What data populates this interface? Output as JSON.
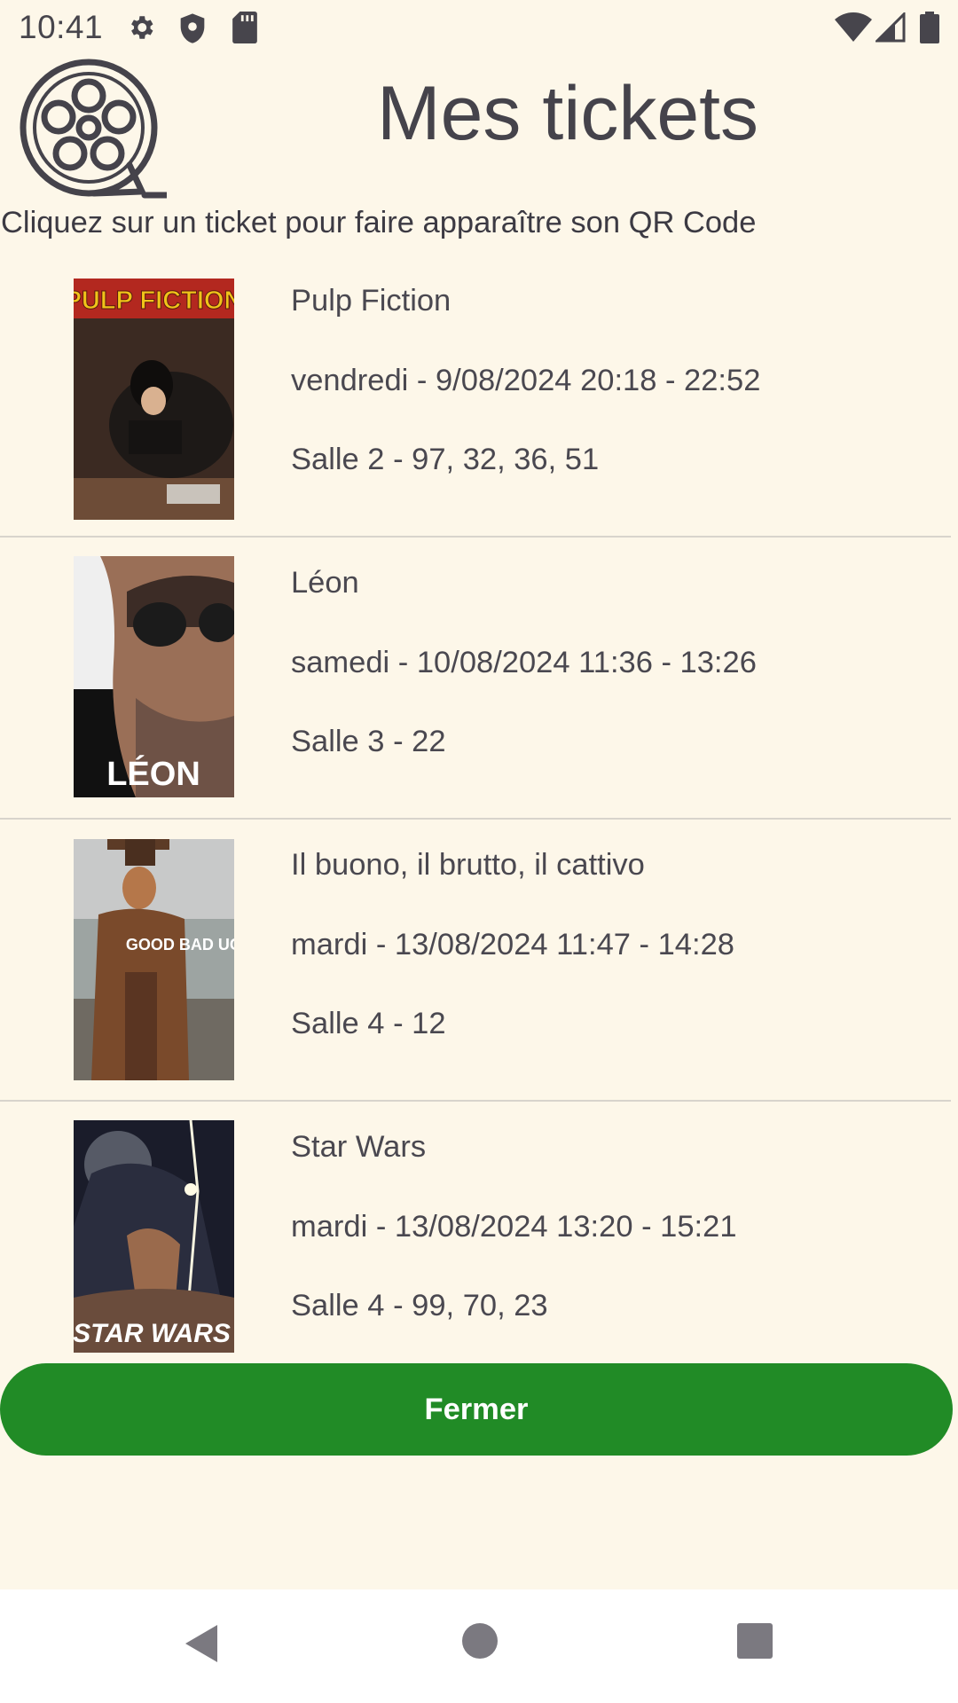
{
  "status_bar": {
    "time": "10:41",
    "left_icons": [
      "gear-icon",
      "shield-icon",
      "sd-card-icon"
    ],
    "right_icons": [
      "wifi-icon",
      "cell-signal-icon",
      "battery-icon"
    ]
  },
  "header": {
    "logo_icon": "film-reel-icon",
    "title": "Mes tickets",
    "instruction": "Cliquez sur un ticket pour faire apparaître son QR Code"
  },
  "tickets": [
    {
      "poster_title": "PULP FICTION",
      "movie": "Pulp Fiction",
      "schedule": "vendredi - 9/08/2024 20:18 - 22:52",
      "seats": "Salle 2 - 97, 32, 36, 51"
    },
    {
      "poster_title": "LÉON",
      "movie": "Léon",
      "schedule": "samedi - 10/08/2024 11:36 - 13:26",
      "seats": "Salle 3 - 22"
    },
    {
      "poster_title": "GOOD BAD UGLY",
      "movie": "Il buono, il brutto, il cattivo",
      "schedule": "mardi - 13/08/2024 11:47 - 14:28",
      "seats": "Salle 4 - 12"
    },
    {
      "poster_title": "STAR WARS",
      "movie": "Star Wars",
      "schedule": "mardi - 13/08/2024 13:20 - 15:21",
      "seats": "Salle 4 - 99, 70, 23"
    }
  ],
  "close_button": {
    "label": "Fermer"
  },
  "colors": {
    "background": "#fdf7e9",
    "accent_green": "#218b26",
    "text": "#3c3a43",
    "divider": "#d8d4cc"
  },
  "nav_bar": {
    "icons": [
      "back-icon",
      "home-icon",
      "recents-icon"
    ]
  }
}
